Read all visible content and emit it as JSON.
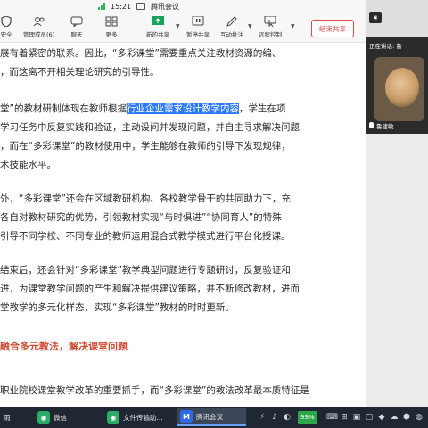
{
  "window": {
    "time": "15:21",
    "app_title": "腾讯会议"
  },
  "toolbar": {
    "security_label": "安全",
    "members_label": "管理成员(6)",
    "chat_label": "聊天",
    "more_label": "更多",
    "new_share_label": "新的共享",
    "pause_share_label": "暂停共享",
    "annotate_label": "互动批注",
    "remote_control_label": "远程控制",
    "end_share_label": "结束共享"
  },
  "document": {
    "lines": [
      "展有着紧密的联系。因此，“多彩课堂”需要重点关注教材资源的编、",
      "，而这离不开相关理论研究的引导性。",
      "学习任务中反复实践和验证，主动设问并发现问题，并自主寻求解决问题",
      "，而在“多彩课堂”的教材使用中，学生能够在教师的引导下发现规律，",
      "术技能水平。",
      "外，“多彩课堂”还会在区域教研机构、各校教学骨干的共同助力下，充",
      "各自对教材研究的优势，引领教材实现“与时俱进”“协同育人”的特殊",
      "引导不同学校、不同专业的教师运用混合式教学模式进行平台化授课。",
      "结束后，还会针对“多彩课堂”教学典型问题进行专题研讨，反复验证和",
      "进，为课堂教学问题的产生和解决提供建议策略，并不断修改教材，进而",
      "堂教学的多元化样态，实现“多彩课堂”教材的时时更新。",
      "职业院校课堂教学改革的重要抓手，而“多彩课堂”的教法改革最本质特征是"
    ],
    "hl_line": {
      "before": "堂”的教材研制体现在教师根据",
      "highlight": "行业企业需求设计教学内容",
      "after": "，学生在项"
    },
    "heading": "融合多元教法，解决课堂问题"
  },
  "video_panel": {
    "speaker_label": "正在讲话: 鲁",
    "user_name": "鲁建敏"
  },
  "taskbar": {
    "item1": "雨",
    "item2": "微信",
    "item3": "文件传输助...",
    "item4": "腾讯会议",
    "battery": "99%"
  },
  "colors": {
    "highlight": "#2a78ff",
    "heading": "#d04a2f",
    "end_share": "#e24b4b",
    "taskbar": "#1f2732"
  }
}
